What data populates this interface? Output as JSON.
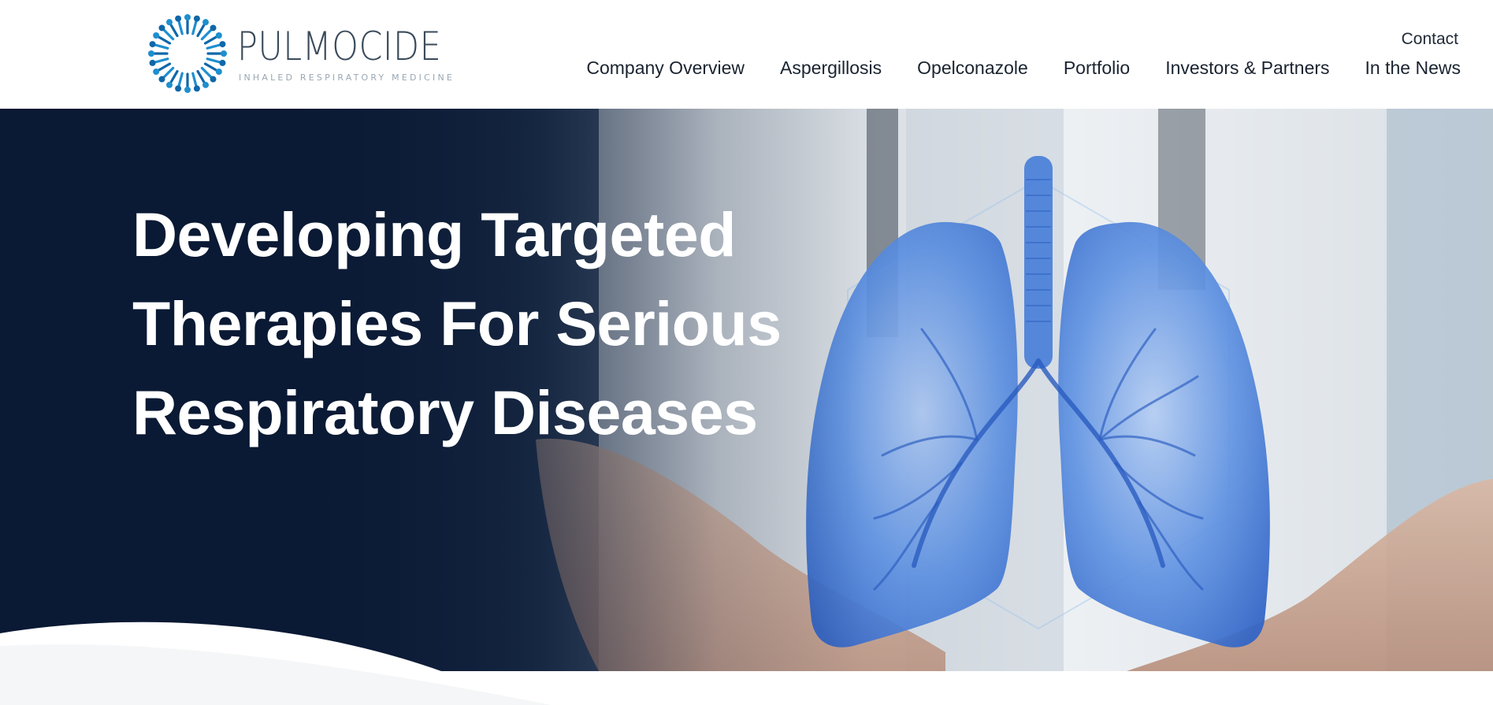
{
  "brand": {
    "name": "PULMOCIDE",
    "tagline": "INHALED RESPIRATORY MEDICINE",
    "logo_icon": "pulmocide-starburst-icon",
    "colors": {
      "logo_blue": "#1e8fcf",
      "logo_blue_dark": "#0f67a9",
      "navy": "#0c1a33",
      "lung_blue": "#3a74d6",
      "text_dark": "#1a2430"
    }
  },
  "header": {
    "contact_label": "Contact",
    "nav": [
      {
        "label": "Company Overview"
      },
      {
        "label": "Aspergillosis"
      },
      {
        "label": "Opelconazole"
      },
      {
        "label": "Portfolio"
      },
      {
        "label": "Investors & Partners"
      },
      {
        "label": "In the News"
      }
    ]
  },
  "hero": {
    "title_lines": [
      "Developing Targeted",
      "Therapies For Serious",
      "Respiratory Diseases"
    ],
    "image_subject": "lungs-illustration"
  }
}
